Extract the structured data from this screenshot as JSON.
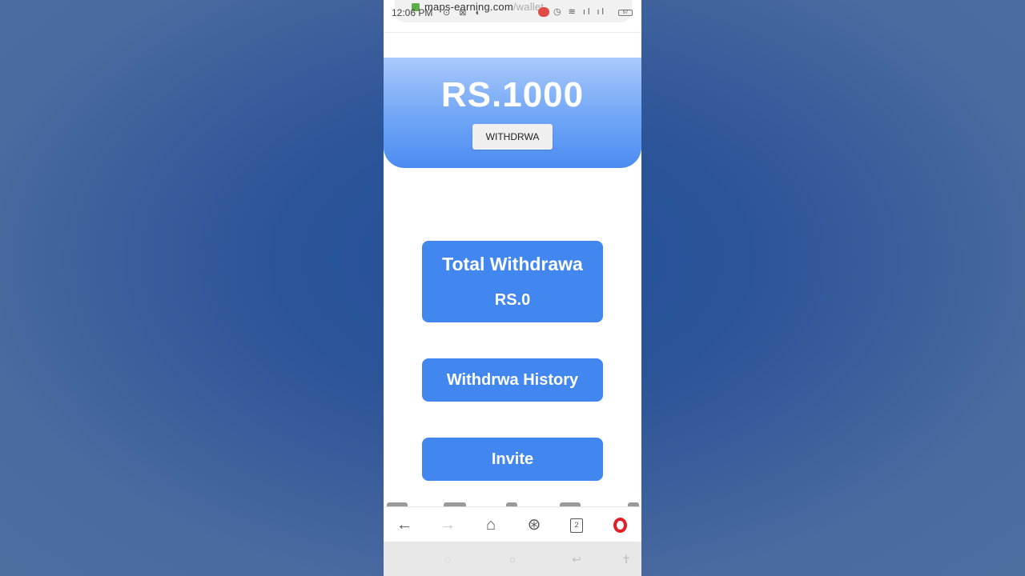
{
  "status_bar": {
    "time": "12:06 PM",
    "url_host": "maps-earning.com",
    "url_path": "/wallet",
    "battery": "97"
  },
  "wallet": {
    "balance": "RS.1000",
    "withdraw_button_label": "WITHDRWA"
  },
  "cards": {
    "total_withdraw_title": "Total Withdrawa",
    "total_withdraw_amount": "RS.0",
    "history_label": "Withdrwa History",
    "invite_label": "Invite"
  },
  "browser_bar": {
    "tab_count": "2",
    "icons": [
      "back-icon",
      "forward-icon",
      "home-icon",
      "speed-dial-icon",
      "tabs-icon",
      "opera-menu-icon"
    ]
  },
  "colors": {
    "accent": "#4287f0",
    "hero_top": "#a9c9fb",
    "hero_bottom": "#4b8cf2",
    "background": "#2d5598",
    "opera_red": "#e01f26"
  }
}
